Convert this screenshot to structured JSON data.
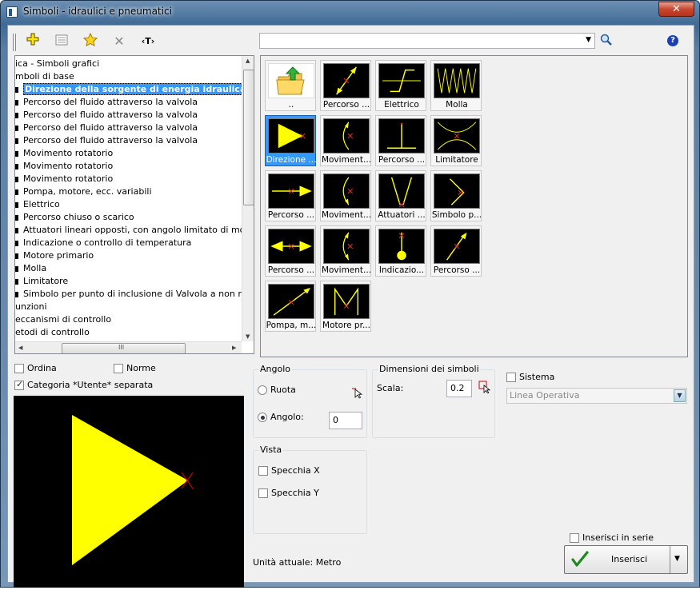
{
  "window": {
    "title": "Simboli - idraulici e pneumatici",
    "close_label": "✕"
  },
  "toolbar": {
    "search_placeholder": ""
  },
  "tree": {
    "items": [
      {
        "label": "ica - Simboli grafici",
        "bullet": false
      },
      {
        "label": "mboli di base",
        "bullet": false
      },
      {
        "label": "Direzione della sorgente di energia idraulica",
        "bullet": true,
        "selected": true
      },
      {
        "label": "Percorso del fluido attraverso la valvola",
        "bullet": true
      },
      {
        "label": "Percorso del fluido attraverso la valvola",
        "bullet": true
      },
      {
        "label": "Percorso del fluido attraverso la valvola",
        "bullet": true
      },
      {
        "label": "Percorso del fluido attraverso la valvola",
        "bullet": true
      },
      {
        "label": "Movimento rotatorio",
        "bullet": true
      },
      {
        "label": "Movimento rotatorio",
        "bullet": true
      },
      {
        "label": "Movimento rotatorio",
        "bullet": true
      },
      {
        "label": "Pompa, motore, ecc. variabili",
        "bullet": true
      },
      {
        "label": "Elettrico",
        "bullet": true
      },
      {
        "label": "Percorso chiuso o scarico",
        "bullet": true
      },
      {
        "label": "Attuatori lineari opposti, con angolo limitato di movimento",
        "bullet": true
      },
      {
        "label": "Indicazione o controllo di temperatura",
        "bullet": true
      },
      {
        "label": "Motore primario",
        "bullet": true
      },
      {
        "label": "Molla",
        "bullet": true
      },
      {
        "label": "Limitatore",
        "bullet": true
      },
      {
        "label": "Simbolo per punto di inclusione di Valvola a non ritorno",
        "bullet": true
      },
      {
        "label": "unzioni",
        "bullet": false
      },
      {
        "label": "eccanismi di controllo",
        "bullet": false
      },
      {
        "label": "etodi di controllo",
        "bullet": false
      }
    ],
    "hscroll_grip": "III"
  },
  "grid": {
    "cells": [
      {
        "label": "..",
        "kind": "folder"
      },
      {
        "label": "Percorso ...",
        "kind": "diag-arrow"
      },
      {
        "label": "Elettrico",
        "kind": "elettrico"
      },
      {
        "label": "Molla",
        "kind": "molla"
      },
      {
        "label": "Direzione ...",
        "kind": "triangle",
        "selected": true
      },
      {
        "label": "Moviment...",
        "kind": "arc"
      },
      {
        "label": "Percorso ...",
        "kind": "tee"
      },
      {
        "label": "Limitatore",
        "kind": "limit"
      },
      {
        "label": "Percorso ...",
        "kind": "h-arrow"
      },
      {
        "label": "Moviment...",
        "kind": "arc2"
      },
      {
        "label": "Attuatori ...",
        "kind": "attuatori"
      },
      {
        "label": "Simbolo p...",
        "kind": "simbolo"
      },
      {
        "label": "Percorso ...",
        "kind": "h-arrow2"
      },
      {
        "label": "Moviment...",
        "kind": "arc3"
      },
      {
        "label": "Indicazio...",
        "kind": "indic"
      },
      {
        "label": "Percorso ...",
        "kind": "diag-arrow2"
      },
      {
        "label": "Pompa, m...",
        "kind": "pompa"
      },
      {
        "label": "Motore pr...",
        "kind": "motore"
      }
    ]
  },
  "options": {
    "ordina": "Ordina",
    "norme": "Norme",
    "categoria": "Categoria *Utente* separata",
    "categoria_checked": true
  },
  "preview": {
    "caption": "Direzione della sorgente di energia idraulica"
  },
  "angolo": {
    "title": "Angolo",
    "ruota": "Ruota",
    "angolo_label": "Angolo:",
    "angolo_value": "0"
  },
  "dimensioni": {
    "title": "Dimensioni dei simboli",
    "scala_label": "Scala:",
    "scala_value": "0.2"
  },
  "sistema": {
    "label": "Sistema",
    "combo_value": "Linea Operativa"
  },
  "vista": {
    "title": "Vista",
    "specchia_x": "Specchia X",
    "specchia_y": "Specchia Y"
  },
  "status": {
    "unita": "Unità attuale: Metro"
  },
  "insert": {
    "serie_label": "Inserisci in serie",
    "button_label": "Inserisci"
  },
  "colors": {
    "symbol": "#ffff00",
    "accent": "#3399ff"
  }
}
